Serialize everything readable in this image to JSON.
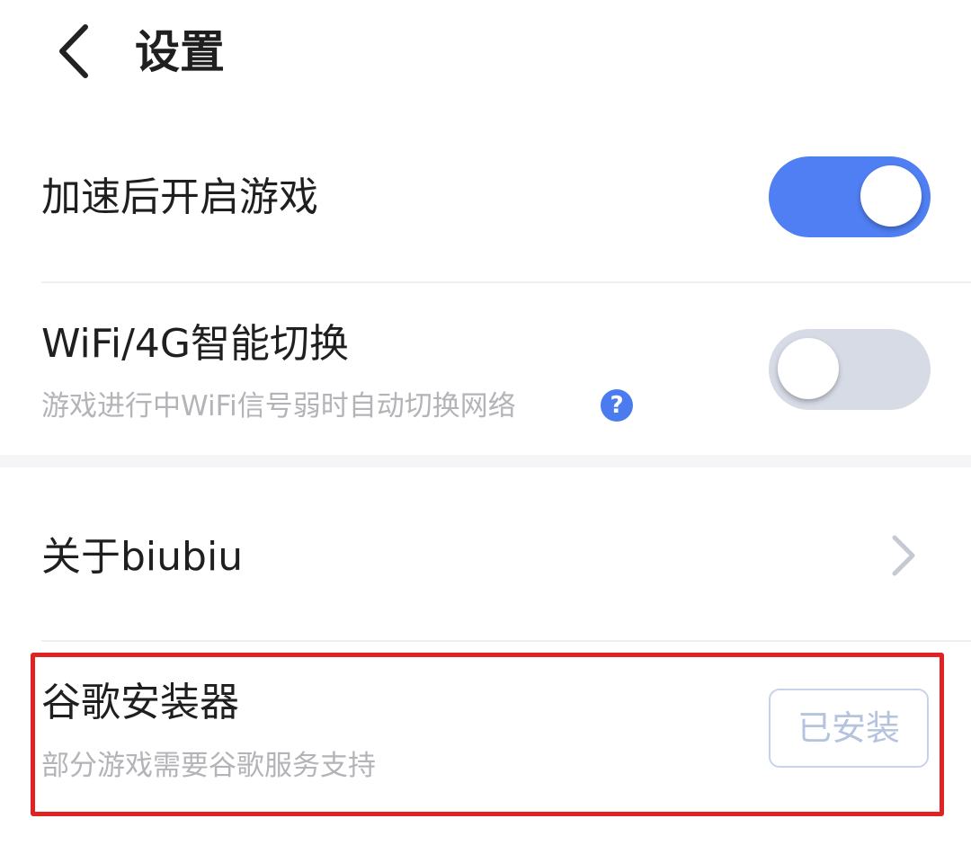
{
  "header": {
    "title": "设置",
    "back_icon": "chevron-left-icon"
  },
  "settings": {
    "launch_after_boost": {
      "label": "加速后开启游戏",
      "enabled": true
    },
    "wifi_4g_switch": {
      "label": "WiFi/4G智能切换",
      "description": "游戏进行中WiFi信号弱时自动切换网络",
      "help_icon": "question-mark-icon",
      "help_glyph": "?",
      "enabled": false
    },
    "about": {
      "label": "关于biubiu",
      "chevron_icon": "chevron-right-icon"
    },
    "google_installer": {
      "label": "谷歌安装器",
      "description": "部分游戏需要谷歌服务支持",
      "button_label": "已安装"
    }
  },
  "colors": {
    "toggle_on": "#4f7ff2",
    "toggle_off": "#d7dbe6",
    "accent_blue": "#4a7cf0",
    "highlight_red": "#e02222"
  }
}
